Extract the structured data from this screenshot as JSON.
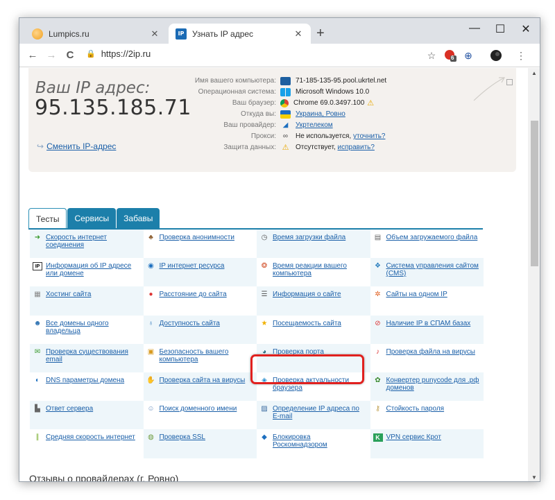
{
  "browser": {
    "tabs": [
      {
        "title": "Lumpics.ru",
        "favicon": "lumpics-orange-circle"
      },
      {
        "title": "Узнать IP адрес",
        "favicon": "ip-blue-square",
        "favicon_text": "IP"
      }
    ],
    "new_tab_icon": "+",
    "address": "https://2ip.ru",
    "window_controls": {
      "minimize": "—",
      "maximize": "☐",
      "close": "✕"
    },
    "nav": {
      "back": "←",
      "forward": "→",
      "reload": "C"
    },
    "extension_badge": "6"
  },
  "ip_panel": {
    "caption": "Ваш IP адрес:",
    "ip": "95.135.185.71",
    "change_link": "Сменить IP-адрес",
    "rows": [
      {
        "label": "Имя вашего компьютера:",
        "value": "71-185-135-95.pool.ukrtel.net",
        "icon": "computer-icon",
        "link": false
      },
      {
        "label": "Операционная система:",
        "value": "Microsoft Windows 10.0",
        "icon": "windows-icon",
        "link": false
      },
      {
        "label": "Ваш браузер:",
        "value": "Chrome 69.0.3497.100",
        "icon": "chrome-icon",
        "link": false,
        "warning": true
      },
      {
        "label": "Откуда вы:",
        "value": "Украина, Ровно",
        "icon": "ukraine-flag-icon",
        "link": true
      },
      {
        "label": "Ваш провайдер:",
        "value": "Укртелеком",
        "icon": "provider-icon",
        "link": true
      },
      {
        "label": "Прокси:",
        "value": "Не используется,",
        "extra_link": "уточнить?",
        "icon": "glasses-icon",
        "link": false
      },
      {
        "label": "Защита данных:",
        "value": "Отсутствует,",
        "extra_link": "исправить?",
        "icon": "warning-icon",
        "link": false
      }
    ]
  },
  "page_tabs": [
    "Тесты",
    "Сервисы",
    "Забавы"
  ],
  "services": [
    [
      {
        "label": "Скорость интернет соединения",
        "icon": "speed-icon"
      },
      {
        "label": "Проверка анонимности",
        "icon": "anonymous-icon"
      },
      {
        "label": "Время загрузки файла",
        "icon": "clock-icon"
      },
      {
        "label": "Объем загружаемого файла",
        "icon": "file-size-icon"
      }
    ],
    [
      {
        "label": "Информация об IP адресе или домене",
        "icon": "ip-info-icon"
      },
      {
        "label": "IP интернет ресурса",
        "icon": "ip-resource-icon"
      },
      {
        "label": "Время реакции вашего компьютера",
        "icon": "reaction-icon"
      },
      {
        "label": "Система управления сайтом (CMS)",
        "icon": "cms-icon"
      }
    ],
    [
      {
        "label": "Хостинг сайта",
        "icon": "hosting-icon"
      },
      {
        "label": "Расстояние до сайта",
        "icon": "map-pin-icon"
      },
      {
        "label": "Информация о сайте",
        "icon": "site-info-icon"
      },
      {
        "label": "Сайты на одном IP",
        "icon": "same-ip-icon"
      }
    ],
    [
      {
        "label": "Все домены одного владельца",
        "icon": "domains-owner-icon"
      },
      {
        "label": "Доступность сайта",
        "icon": "availability-icon"
      },
      {
        "label": "Посещаемость сайта",
        "icon": "star-icon"
      },
      {
        "label": "Наличие IP в СПАМ базах",
        "icon": "spam-icon"
      }
    ],
    [
      {
        "label": "Проверка существования email",
        "icon": "email-icon"
      },
      {
        "label": "Безопасность вашего компьютера",
        "icon": "security-icon"
      },
      {
        "label": "Проверка порта",
        "icon": "port-icon"
      },
      {
        "label": "Проверка файла на вирусы",
        "icon": "virus-file-icon"
      }
    ],
    [
      {
        "label": "DNS параметры домена",
        "icon": "dns-icon"
      },
      {
        "label": "Проверка сайта на вирусы",
        "icon": "virus-site-icon"
      },
      {
        "label": "Проверка актуальности браузера",
        "icon": "browser-icon"
      },
      {
        "label": "Конвертер punycode для .рф доменов",
        "icon": "punycode-icon"
      }
    ],
    [
      {
        "label": "Ответ сервера",
        "icon": "server-icon"
      },
      {
        "label": "Поиск доменного имени",
        "icon": "domain-search-icon"
      },
      {
        "label": "Определение IP адреса по E-mail",
        "icon": "ip-by-email-icon"
      },
      {
        "label": "Стойкость пароля",
        "icon": "password-icon"
      }
    ],
    [
      {
        "label": "Средняя скорость интернет",
        "icon": "avg-speed-icon"
      },
      {
        "label": "Проверка SSL",
        "icon": "ssl-icon"
      },
      {
        "label": "Блокировка Роскомнадзором",
        "icon": "block-icon"
      },
      {
        "label": "VPN сервис Крот",
        "icon": "vpn-icon"
      }
    ]
  ],
  "highlighted_service": "Проверка порта",
  "section_below": "Отзывы о провайдерах (г. Ровно)",
  "colors": {
    "accent": "#1c7faa",
    "link": "#1a5fa8",
    "highlight": "#e1201e",
    "panel_bg": "#f4f1ee"
  }
}
